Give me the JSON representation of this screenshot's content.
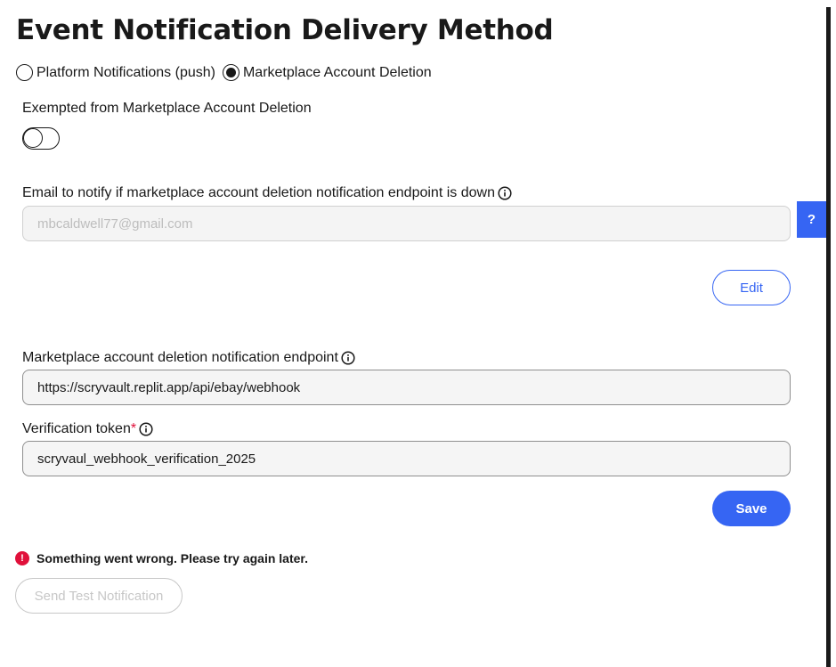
{
  "page": {
    "title": "Event Notification Delivery Method"
  },
  "delivery_method": {
    "options": [
      {
        "label": "Platform Notifications (push)",
        "selected": false
      },
      {
        "label": "Marketplace Account Deletion",
        "selected": true
      }
    ]
  },
  "exemption": {
    "label": "Exempted from Marketplace Account Deletion",
    "enabled": false
  },
  "email": {
    "label": "Email to notify if marketplace account deletion notification endpoint is down",
    "placeholder": "mbcaldwell77@gmail.com",
    "value": "",
    "edit_label": "Edit"
  },
  "endpoint": {
    "label": "Marketplace account deletion notification endpoint",
    "value": "https://scryvault.replit.app/api/ebay/webhook"
  },
  "token": {
    "label": "Verification token",
    "required_mark": "*",
    "value": "scryvaul_webhook_verification_2025"
  },
  "actions": {
    "save_label": "Save",
    "send_test_label": "Send Test Notification"
  },
  "error": {
    "icon": "!",
    "message": "Something went wrong. Please try again later."
  },
  "help": {
    "label": "?"
  },
  "colors": {
    "accent": "#3665f3",
    "error": "#e0103a",
    "text": "#191919"
  }
}
